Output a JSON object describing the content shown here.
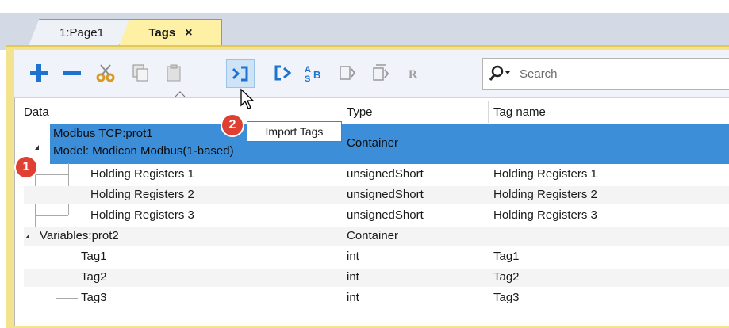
{
  "tabs": [
    {
      "label": "1:Page1"
    },
    {
      "label": "Tags",
      "close": "×"
    }
  ],
  "toolbar": {
    "buttons": [
      "add-icon",
      "remove-icon",
      "cut-icon",
      "copy-icon",
      "paste-icon",
      "import-tags-icon",
      "export-tags-icon",
      "convert-icon",
      "tag-list-icon",
      "tag-group-icon",
      "r-icon"
    ],
    "search_placeholder": "Search",
    "tooltip": "Import Tags"
  },
  "columns": [
    "Data",
    "Type",
    "Tag name"
  ],
  "tree": [
    {
      "label_line1": "Modbus TCP:prot1",
      "label_line2": "Model: Modicon Modbus(1-based)",
      "type": "Container",
      "tag": "",
      "selected": true,
      "children": [
        {
          "label": "Holding Registers 1",
          "type": "unsignedShort",
          "tag": "Holding Registers 1"
        },
        {
          "label": "Holding Registers 2",
          "type": "unsignedShort",
          "tag": "Holding Registers 2"
        },
        {
          "label": "Holding Registers 3",
          "type": "unsignedShort",
          "tag": "Holding Registers 3"
        }
      ]
    },
    {
      "label": "Variables:prot2",
      "type": "Container",
      "tag": "",
      "children": [
        {
          "label": "Tag1",
          "type": "int",
          "tag": "Tag1"
        },
        {
          "label": "Tag2",
          "type": "int",
          "tag": "Tag2"
        },
        {
          "label": "Tag3",
          "type": "int",
          "tag": "Tag3"
        }
      ]
    }
  ],
  "callouts": [
    "1",
    "2"
  ],
  "colors": {
    "selection": "#3d8ed8",
    "tab_active": "#fef1a6",
    "badge": "#e04032",
    "accent_blue": "#1e73d2"
  }
}
